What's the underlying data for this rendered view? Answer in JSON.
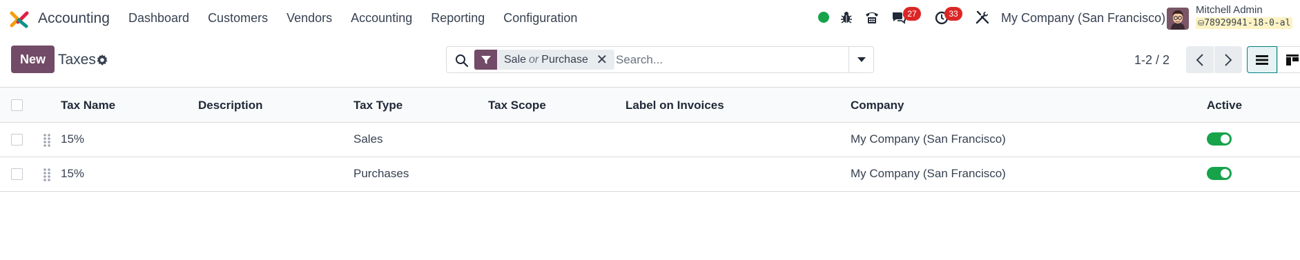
{
  "app": {
    "name": "Accounting"
  },
  "menu": [
    "Dashboard",
    "Customers",
    "Vendors",
    "Accounting",
    "Reporting",
    "Configuration"
  ],
  "systray": {
    "messages_count": "27",
    "activities_count": "33",
    "company": "My Company (San Francisco)",
    "user_name": "Mitchell Admin",
    "db_name": "78929941-18-0-al"
  },
  "control": {
    "new_label": "New",
    "title": "Taxes",
    "search_placeholder": "Search...",
    "facet": {
      "value1": "Sale",
      "separator": "or",
      "value2": "Purchase"
    },
    "pager": "1-2 / 2"
  },
  "table": {
    "headers": {
      "tax_name": "Tax Name",
      "description": "Description",
      "tax_type": "Tax Type",
      "tax_scope": "Tax Scope",
      "label_on_invoices": "Label on Invoices",
      "company": "Company",
      "active": "Active"
    },
    "rows": [
      {
        "tax_name": "15%",
        "description": "",
        "tax_type": "Sales",
        "tax_scope": "",
        "label_on_invoices": "",
        "company": "My Company (San Francisco)",
        "active": true
      },
      {
        "tax_name": "15%",
        "description": "",
        "tax_type": "Purchases",
        "tax_scope": "",
        "label_on_invoices": "",
        "company": "My Company (San Francisco)",
        "active": true
      }
    ]
  },
  "colors": {
    "brand": "#714b67",
    "active_toggle": "#16a34a",
    "badge": "#dc2626",
    "accent": "#017e84"
  }
}
